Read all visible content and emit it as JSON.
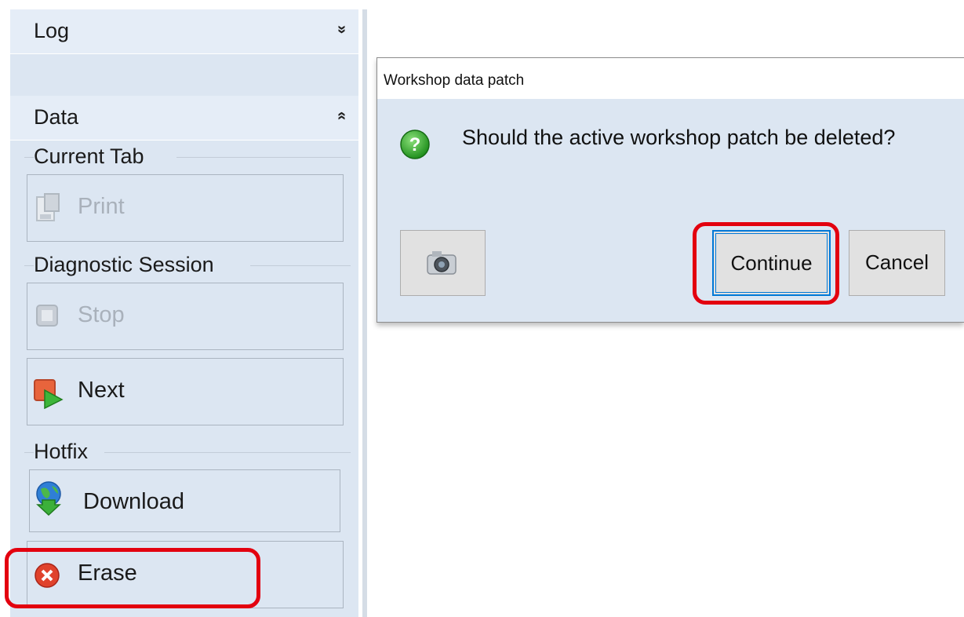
{
  "panel": {
    "log_header": {
      "title": "Log",
      "chevron": "»"
    },
    "data_header": {
      "title": "Data",
      "chevron": "«"
    },
    "groups": {
      "current_tab": {
        "title": "Current Tab",
        "print_label": "Print"
      },
      "diagnostic_session": {
        "title": "Diagnostic Session",
        "stop_label": "Stop",
        "next_label": "Next"
      },
      "hotfix": {
        "title": "Hotfix",
        "download_label": "Download",
        "erase_label": "Erase"
      }
    }
  },
  "dialog": {
    "title": "Workshop data patch",
    "message": "Should the active workshop patch be deleted?",
    "continue_label": "Continue",
    "cancel_label": "Cancel",
    "icons": {
      "question": "question-icon",
      "camera": "camera-icon"
    }
  },
  "colors": {
    "panel_bg": "#dce6f2",
    "highlight": "#e3000f",
    "focus_border": "#0078d7"
  }
}
